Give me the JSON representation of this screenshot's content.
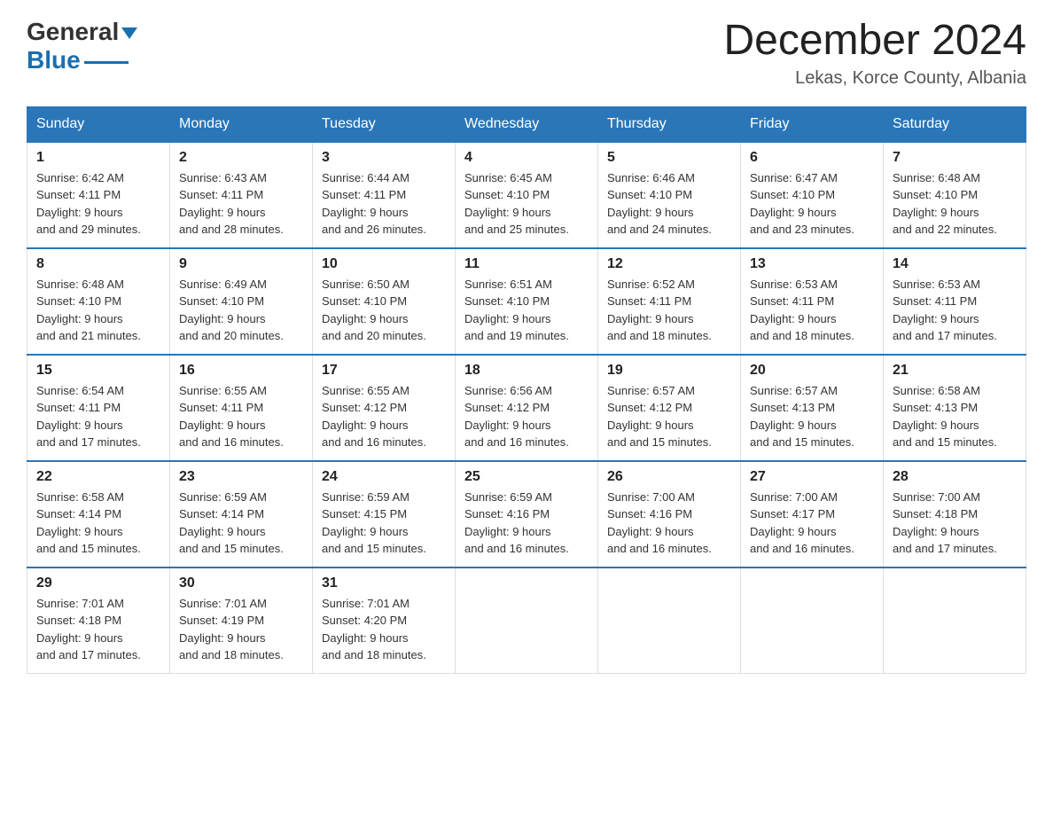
{
  "header": {
    "logo": {
      "part1": "General",
      "part2": "Blue"
    },
    "title": "December 2024",
    "location": "Lekas, Korce County, Albania"
  },
  "calendar": {
    "days_of_week": [
      "Sunday",
      "Monday",
      "Tuesday",
      "Wednesday",
      "Thursday",
      "Friday",
      "Saturday"
    ],
    "weeks": [
      [
        {
          "day": "1",
          "sunrise": "Sunrise: 6:42 AM",
          "sunset": "Sunset: 4:11 PM",
          "daylight": "Daylight: 9 hours and 29 minutes."
        },
        {
          "day": "2",
          "sunrise": "Sunrise: 6:43 AM",
          "sunset": "Sunset: 4:11 PM",
          "daylight": "Daylight: 9 hours and 28 minutes."
        },
        {
          "day": "3",
          "sunrise": "Sunrise: 6:44 AM",
          "sunset": "Sunset: 4:11 PM",
          "daylight": "Daylight: 9 hours and 26 minutes."
        },
        {
          "day": "4",
          "sunrise": "Sunrise: 6:45 AM",
          "sunset": "Sunset: 4:10 PM",
          "daylight": "Daylight: 9 hours and 25 minutes."
        },
        {
          "day": "5",
          "sunrise": "Sunrise: 6:46 AM",
          "sunset": "Sunset: 4:10 PM",
          "daylight": "Daylight: 9 hours and 24 minutes."
        },
        {
          "day": "6",
          "sunrise": "Sunrise: 6:47 AM",
          "sunset": "Sunset: 4:10 PM",
          "daylight": "Daylight: 9 hours and 23 minutes."
        },
        {
          "day": "7",
          "sunrise": "Sunrise: 6:48 AM",
          "sunset": "Sunset: 4:10 PM",
          "daylight": "Daylight: 9 hours and 22 minutes."
        }
      ],
      [
        {
          "day": "8",
          "sunrise": "Sunrise: 6:48 AM",
          "sunset": "Sunset: 4:10 PM",
          "daylight": "Daylight: 9 hours and 21 minutes."
        },
        {
          "day": "9",
          "sunrise": "Sunrise: 6:49 AM",
          "sunset": "Sunset: 4:10 PM",
          "daylight": "Daylight: 9 hours and 20 minutes."
        },
        {
          "day": "10",
          "sunrise": "Sunrise: 6:50 AM",
          "sunset": "Sunset: 4:10 PM",
          "daylight": "Daylight: 9 hours and 20 minutes."
        },
        {
          "day": "11",
          "sunrise": "Sunrise: 6:51 AM",
          "sunset": "Sunset: 4:10 PM",
          "daylight": "Daylight: 9 hours and 19 minutes."
        },
        {
          "day": "12",
          "sunrise": "Sunrise: 6:52 AM",
          "sunset": "Sunset: 4:11 PM",
          "daylight": "Daylight: 9 hours and 18 minutes."
        },
        {
          "day": "13",
          "sunrise": "Sunrise: 6:53 AM",
          "sunset": "Sunset: 4:11 PM",
          "daylight": "Daylight: 9 hours and 18 minutes."
        },
        {
          "day": "14",
          "sunrise": "Sunrise: 6:53 AM",
          "sunset": "Sunset: 4:11 PM",
          "daylight": "Daylight: 9 hours and 17 minutes."
        }
      ],
      [
        {
          "day": "15",
          "sunrise": "Sunrise: 6:54 AM",
          "sunset": "Sunset: 4:11 PM",
          "daylight": "Daylight: 9 hours and 17 minutes."
        },
        {
          "day": "16",
          "sunrise": "Sunrise: 6:55 AM",
          "sunset": "Sunset: 4:11 PM",
          "daylight": "Daylight: 9 hours and 16 minutes."
        },
        {
          "day": "17",
          "sunrise": "Sunrise: 6:55 AM",
          "sunset": "Sunset: 4:12 PM",
          "daylight": "Daylight: 9 hours and 16 minutes."
        },
        {
          "day": "18",
          "sunrise": "Sunrise: 6:56 AM",
          "sunset": "Sunset: 4:12 PM",
          "daylight": "Daylight: 9 hours and 16 minutes."
        },
        {
          "day": "19",
          "sunrise": "Sunrise: 6:57 AM",
          "sunset": "Sunset: 4:12 PM",
          "daylight": "Daylight: 9 hours and 15 minutes."
        },
        {
          "day": "20",
          "sunrise": "Sunrise: 6:57 AM",
          "sunset": "Sunset: 4:13 PM",
          "daylight": "Daylight: 9 hours and 15 minutes."
        },
        {
          "day": "21",
          "sunrise": "Sunrise: 6:58 AM",
          "sunset": "Sunset: 4:13 PM",
          "daylight": "Daylight: 9 hours and 15 minutes."
        }
      ],
      [
        {
          "day": "22",
          "sunrise": "Sunrise: 6:58 AM",
          "sunset": "Sunset: 4:14 PM",
          "daylight": "Daylight: 9 hours and 15 minutes."
        },
        {
          "day": "23",
          "sunrise": "Sunrise: 6:59 AM",
          "sunset": "Sunset: 4:14 PM",
          "daylight": "Daylight: 9 hours and 15 minutes."
        },
        {
          "day": "24",
          "sunrise": "Sunrise: 6:59 AM",
          "sunset": "Sunset: 4:15 PM",
          "daylight": "Daylight: 9 hours and 15 minutes."
        },
        {
          "day": "25",
          "sunrise": "Sunrise: 6:59 AM",
          "sunset": "Sunset: 4:16 PM",
          "daylight": "Daylight: 9 hours and 16 minutes."
        },
        {
          "day": "26",
          "sunrise": "Sunrise: 7:00 AM",
          "sunset": "Sunset: 4:16 PM",
          "daylight": "Daylight: 9 hours and 16 minutes."
        },
        {
          "day": "27",
          "sunrise": "Sunrise: 7:00 AM",
          "sunset": "Sunset: 4:17 PM",
          "daylight": "Daylight: 9 hours and 16 minutes."
        },
        {
          "day": "28",
          "sunrise": "Sunrise: 7:00 AM",
          "sunset": "Sunset: 4:18 PM",
          "daylight": "Daylight: 9 hours and 17 minutes."
        }
      ],
      [
        {
          "day": "29",
          "sunrise": "Sunrise: 7:01 AM",
          "sunset": "Sunset: 4:18 PM",
          "daylight": "Daylight: 9 hours and 17 minutes."
        },
        {
          "day": "30",
          "sunrise": "Sunrise: 7:01 AM",
          "sunset": "Sunset: 4:19 PM",
          "daylight": "Daylight: 9 hours and 18 minutes."
        },
        {
          "day": "31",
          "sunrise": "Sunrise: 7:01 AM",
          "sunset": "Sunset: 4:20 PM",
          "daylight": "Daylight: 9 hours and 18 minutes."
        },
        null,
        null,
        null,
        null
      ]
    ]
  }
}
